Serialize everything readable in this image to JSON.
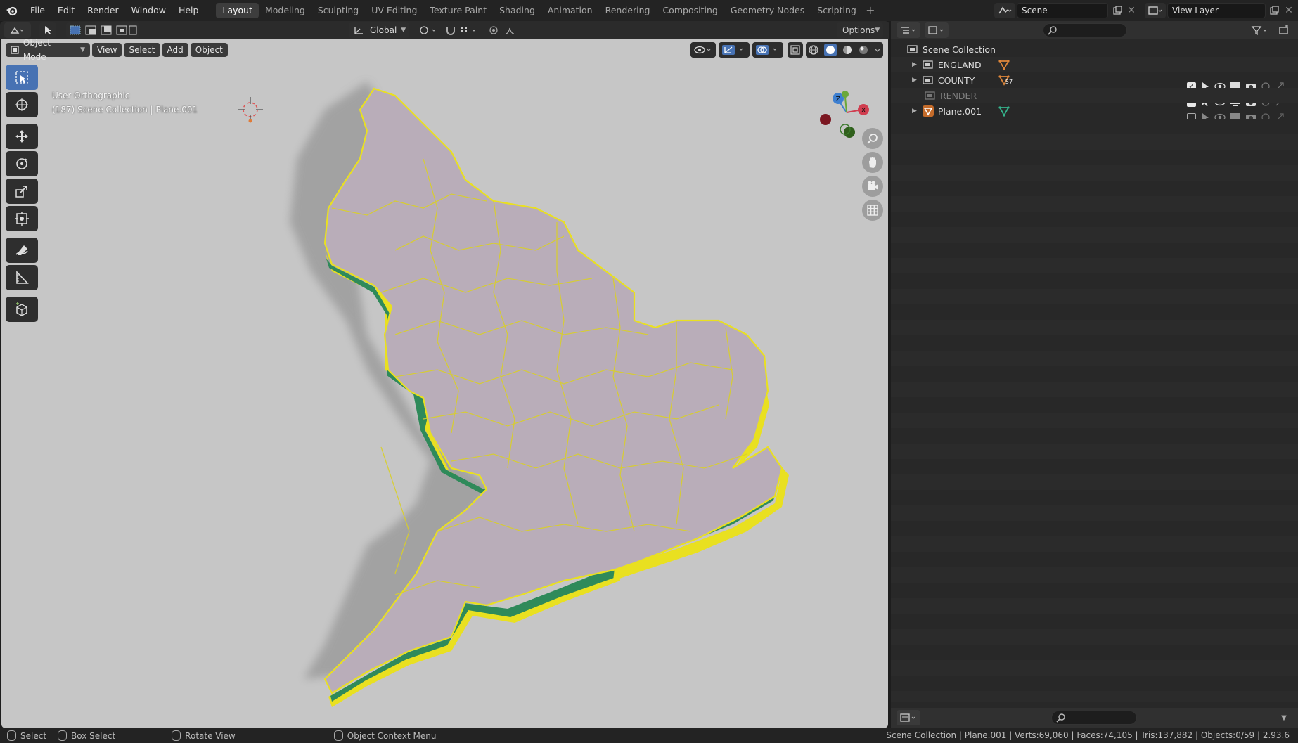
{
  "menus": [
    "File",
    "Edit",
    "Render",
    "Window",
    "Help"
  ],
  "workspace_tabs": [
    {
      "label": "Layout",
      "active": true
    },
    {
      "label": "Modeling"
    },
    {
      "label": "Sculpting"
    },
    {
      "label": "UV Editing"
    },
    {
      "label": "Texture Paint"
    },
    {
      "label": "Shading"
    },
    {
      "label": "Animation"
    },
    {
      "label": "Rendering"
    },
    {
      "label": "Compositing"
    },
    {
      "label": "Geometry Nodes"
    },
    {
      "label": "Scripting"
    }
  ],
  "tab_add": "+",
  "scene": {
    "name": "Scene",
    "view_layer": "View Layer"
  },
  "viewport_header": {
    "transform_orientation": "Global",
    "options_label": "Options",
    "mode": "Object Mode",
    "menus": [
      "View",
      "Select",
      "Add",
      "Object"
    ]
  },
  "viewport_overlay_text": {
    "view_name": "User Orthographic",
    "context": "(187) Scene Collection | Plane.001"
  },
  "gizmo_axes": {
    "x": "X",
    "y": "Y",
    "z": "Z"
  },
  "colors": {
    "map_fill": "#b8acb8",
    "map_border": "#e9e020",
    "extrude_green": "#2f8a5a",
    "viewport_bg": "#c6c6c6",
    "accent": "#4772b3"
  },
  "outliner": {
    "root": "Scene Collection",
    "items": [
      {
        "name": "ENGLAND",
        "type": "collection",
        "checked": true,
        "child_icon": "mesh-icon",
        "badge": ""
      },
      {
        "name": "COUNTY",
        "type": "collection",
        "checked": true,
        "child_icon": "mesh-icon",
        "badge": "57"
      },
      {
        "name": "RENDER",
        "type": "collection",
        "checked": false,
        "child_icon": "",
        "badge": "",
        "disabled": true
      },
      {
        "name": "Plane.001",
        "type": "object",
        "child_icon": "modifier-icon",
        "badge": ""
      }
    ]
  },
  "status": {
    "select": "Select",
    "box_select": "Box Select",
    "rotate_view": "Rotate View",
    "context_menu": "Object Context Menu",
    "stats": "Scene Collection | Plane.001 | Verts:69,060 | Faces:74,105 | Tris:137,882 | Objects:0/59 | 2.93.6"
  }
}
